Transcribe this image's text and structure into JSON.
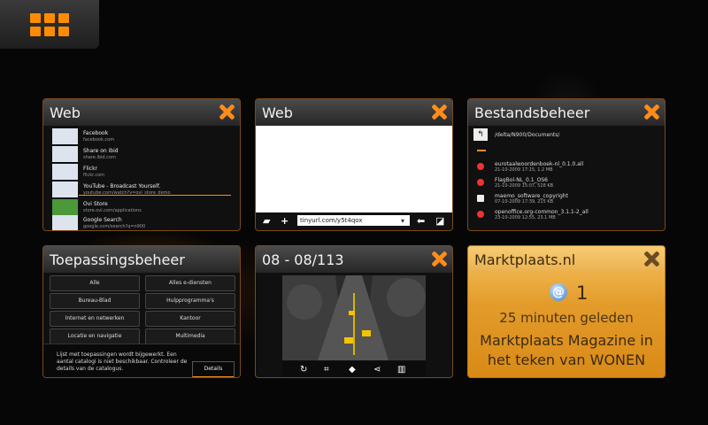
{
  "colors": {
    "accent": "#ff8c00",
    "notification": "#e39b2a"
  },
  "switcher": {
    "icon": "app-grid-icon"
  },
  "windows": [
    {
      "title": "Web",
      "items": [
        {
          "t1": "Facebook",
          "t2": "facebook.com"
        },
        {
          "t1": "Share on ibid",
          "t2": "share.ibid.com"
        },
        {
          "t1": "Flickr",
          "t2": "flickr.com"
        },
        {
          "t1": "YouTube - Broadcast Yourself.",
          "t2": "youtube.com/watch?v=ovi_store_demo"
        },
        {
          "t1": "Ovi Store",
          "t2": "store.ovi.com/applications"
        },
        {
          "t1": "Google Search",
          "t2": "google.com/search?q=n900"
        }
      ]
    },
    {
      "title": "Web",
      "url": "tinyurl.com/y5t4qox"
    },
    {
      "title": "Bestandsbeheer",
      "path": "/delta/N900/Documents/",
      "files": [
        {
          "t1": "eurotaalwoordenboek-nl_0.1.0.all",
          "t2": "21-10-2009 17:15, 1.2 MB"
        },
        {
          "t1": "FlagBol-NL_0.1_OS6",
          "t2": "21-10-2009 15:07, 528 KB"
        },
        {
          "t1": "maemo_software_copyright",
          "t2": "07-10-2009 17:39, 215 KB"
        },
        {
          "t1": "openoffice.org-common_3.1.1-2_all",
          "t2": "23-10-2009 12:55, 23.1 MB"
        }
      ]
    },
    {
      "title": "Toepassingsbeheer",
      "buttons": [
        "Alle",
        "Alles e-diensten",
        "Bureau-Blad",
        "Hulpprogramma's",
        "Internet en netwerken",
        "Kantoor",
        "Locatie en navigatie",
        "Multimedia"
      ],
      "notice": "Lijst met toepassingen wordt bijgewerkt. Een aantal catalogi is niet beschikbaar. Controleer de details van de catalogus.",
      "notice_button": "Details"
    },
    {
      "title": "08 - 08/113"
    }
  ],
  "notification": {
    "title": "Marktplaats.nl",
    "icon": "at-icon",
    "count": "1",
    "time": "25 minuten geleden",
    "message": "Marktplaats Magazine in het teken van WONEN"
  }
}
